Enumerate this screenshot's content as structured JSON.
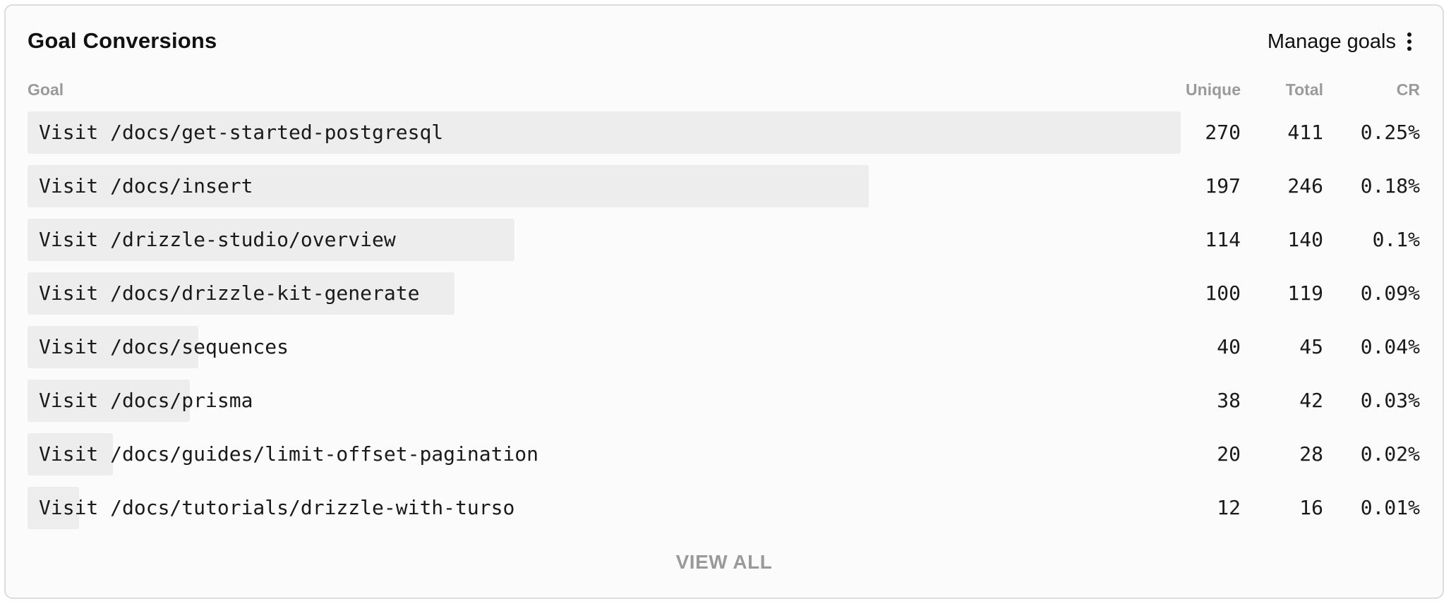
{
  "panel": {
    "title": "Goal Conversions",
    "manage_label": "Manage goals",
    "menu_icon": "kebab-vertical-icon",
    "view_all_label": "VIEW ALL"
  },
  "table": {
    "headers": {
      "goal": "Goal",
      "unique": "Unique",
      "total": "Total",
      "cr": "CR"
    },
    "rows": [
      {
        "goal": "Visit /docs/get-started-postgresql",
        "unique": "270",
        "total": "411",
        "cr": "0.25%"
      },
      {
        "goal": "Visit /docs/insert",
        "unique": "197",
        "total": "246",
        "cr": "0.18%"
      },
      {
        "goal": "Visit /drizzle-studio/overview",
        "unique": "114",
        "total": "140",
        "cr": "0.1%"
      },
      {
        "goal": "Visit /docs/drizzle-kit-generate",
        "unique": "100",
        "total": "119",
        "cr": "0.09%"
      },
      {
        "goal": "Visit /docs/sequences",
        "unique": "40",
        "total": "45",
        "cr": "0.04%"
      },
      {
        "goal": "Visit /docs/prisma",
        "unique": "38",
        "total": "42",
        "cr": "0.03%"
      },
      {
        "goal": "Visit /docs/guides/limit-offset-pagination",
        "unique": "20",
        "total": "28",
        "cr": "0.02%"
      },
      {
        "goal": "Visit /docs/tutorials/drizzle-with-turso",
        "unique": "12",
        "total": "16",
        "cr": "0.01%"
      }
    ]
  },
  "colors": {
    "bar": "#ededed",
    "muted_text": "#9a9a9a",
    "text": "#111111"
  }
}
